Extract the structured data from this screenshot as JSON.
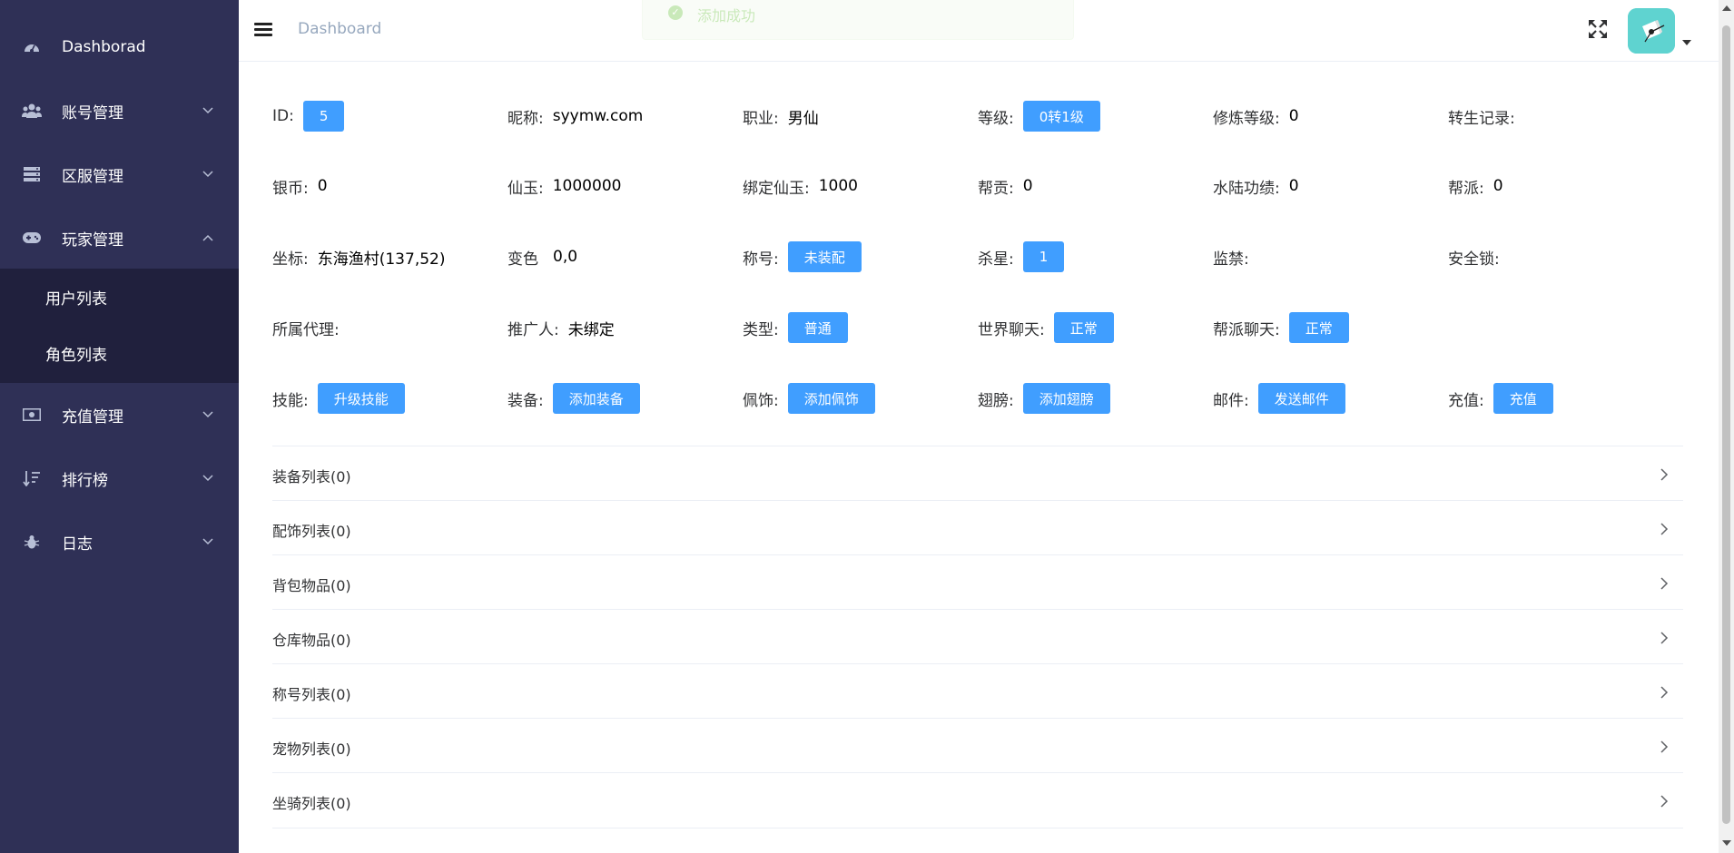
{
  "sidebar": {
    "items": [
      {
        "label": "Dashborad",
        "icon": "dashboard-gauge-icon"
      },
      {
        "label": "账号管理",
        "icon": "users-icon"
      },
      {
        "label": "区服管理",
        "icon": "server-icon"
      },
      {
        "label": "玩家管理",
        "icon": "gamepad-icon"
      },
      {
        "label": "充值管理",
        "icon": "money-icon"
      },
      {
        "label": "排行榜",
        "icon": "sort-icon"
      },
      {
        "label": "日志",
        "icon": "bug-icon"
      }
    ],
    "subitems": [
      {
        "label": "用户列表"
      },
      {
        "label": "角色列表"
      }
    ],
    "colors": {
      "background": "#2f3056",
      "submenu_background": "#20203d"
    }
  },
  "header": {
    "breadcrumb": "Dashboard",
    "toast_text": "添加成功"
  },
  "info": {
    "id_label": "ID:",
    "id_value": "5",
    "nickname_label": "昵称:",
    "nickname_value": "syymw.com",
    "profession_label": "职业:",
    "profession_value": "男仙",
    "level_label": "等级:",
    "level_value": "0转1级",
    "cultivation_label": "修炼等级:",
    "cultivation_value": "0",
    "rebirth_label": "转生记录:",
    "silver_label": "银币:",
    "silver_value": "0",
    "jade_label": "仙玉:",
    "jade_value": "1000000",
    "bound_jade_label": "绑定仙玉:",
    "bound_jade_value": "1000",
    "contribution_label": "帮贡:",
    "contribution_value": "0",
    "merit_label": "水陆功绩:",
    "merit_value": "0",
    "guild_label": "帮派:",
    "guild_value": "0",
    "coord_label": "坐标:",
    "coord_value": "东海渔村(137,52)",
    "color_label": "变色",
    "color_value": "0,0",
    "title_label": "称号:",
    "title_value": "未装配",
    "kill_label": "杀星:",
    "kill_value": "1",
    "jail_label": "监禁:",
    "lock_label": "安全锁:",
    "agent_label": "所属代理:",
    "promoter_label": "推广人:",
    "promoter_value": "未绑定",
    "type_label": "类型:",
    "type_value": "普通",
    "world_chat_label": "世界聊天:",
    "world_chat_value": "正常",
    "guild_chat_label": "帮派聊天:",
    "guild_chat_value": "正常",
    "skill_label": "技能:",
    "skill_button": "升级技能",
    "equip_label": "装备:",
    "equip_button": "添加装备",
    "accessory_label": "佩饰:",
    "accessory_button": "添加佩饰",
    "wing_label": "翅膀:",
    "wing_button": "添加翅膀",
    "mail_label": "邮件:",
    "mail_button": "发送邮件",
    "recharge_label": "充值:",
    "recharge_button": "充值"
  },
  "collapse": [
    {
      "title": "装备列表(0)"
    },
    {
      "title": "配饰列表(0)"
    },
    {
      "title": "背包物品(0)"
    },
    {
      "title": "仓库物品(0)"
    },
    {
      "title": "称号列表(0)"
    },
    {
      "title": "宠物列表(0)"
    },
    {
      "title": "坐骑列表(0)"
    }
  ],
  "accent_color": "#409eff"
}
